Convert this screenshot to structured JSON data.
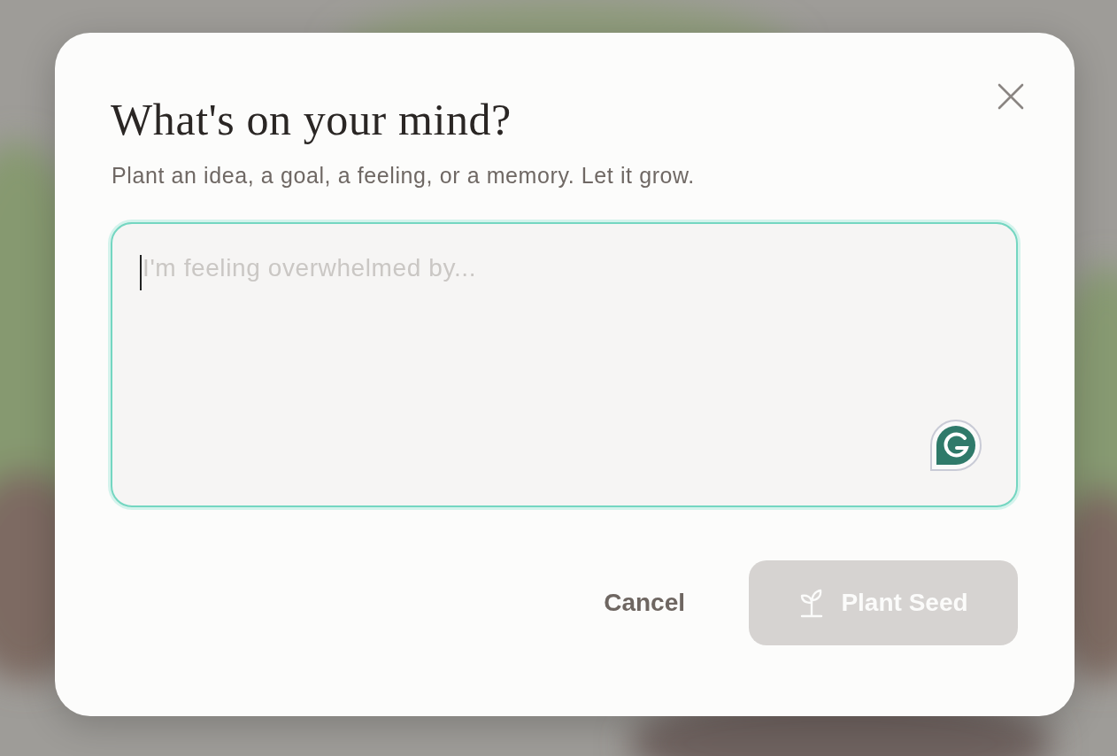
{
  "dialog": {
    "title": "What's on your mind?",
    "subtitle": "Plant an idea, a goal, a feeling, or a memory. Let it grow.",
    "entry": {
      "placeholder": "I'm feeling overwhelmed by...",
      "focused": true
    },
    "buttons": [
      {
        "kind": "text",
        "label": "Cancel",
        "disabled": false
      },
      {
        "kind": "primary",
        "label": "Plant Seed",
        "disabled": true
      }
    ]
  }
}
